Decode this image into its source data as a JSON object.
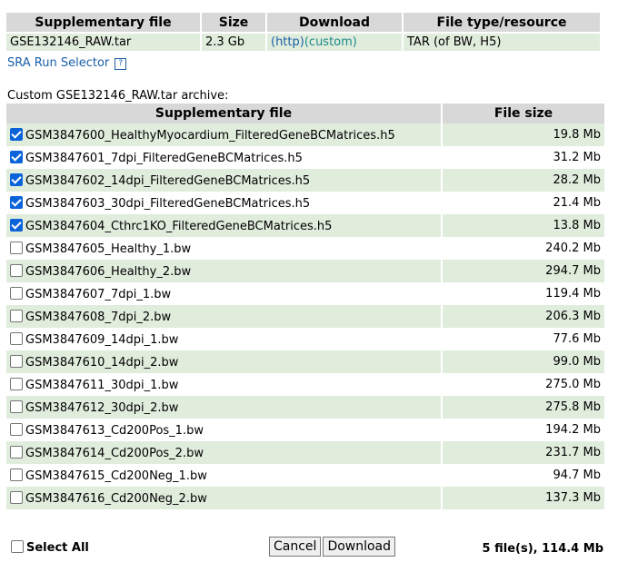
{
  "top_table": {
    "headers": [
      "Supplementary file",
      "Size",
      "Download",
      "File type/resource"
    ],
    "row": {
      "file": "GSE132146_RAW.tar",
      "size": "2.3 Gb",
      "http": "(http)",
      "custom": "(custom)",
      "type": "TAR (of BW, H5)"
    }
  },
  "sra_link": "SRA Run Selector",
  "help_glyph": "?",
  "archive_caption": "Custom GSE132146_RAW.tar archive:",
  "file_table": {
    "headers": [
      "Supplementary file",
      "File size"
    ],
    "rows": [
      {
        "name": "GSM3847600_HealthyMyocardium_FilteredGeneBCMatrices.h5",
        "size": "19.8 Mb",
        "checked": true
      },
      {
        "name": "GSM3847601_7dpi_FilteredGeneBCMatrices.h5",
        "size": "31.2 Mb",
        "checked": true
      },
      {
        "name": "GSM3847602_14dpi_FilteredGeneBCMatrices.h5",
        "size": "28.2 Mb",
        "checked": true
      },
      {
        "name": "GSM3847603_30dpi_FilteredGeneBCMatrices.h5",
        "size": "21.4 Mb",
        "checked": true
      },
      {
        "name": "GSM3847604_Cthrc1KO_FilteredGeneBCMatrices.h5",
        "size": "13.8 Mb",
        "checked": true
      },
      {
        "name": "GSM3847605_Healthy_1.bw",
        "size": "240.2 Mb",
        "checked": false
      },
      {
        "name": "GSM3847606_Healthy_2.bw",
        "size": "294.7 Mb",
        "checked": false
      },
      {
        "name": "GSM3847607_7dpi_1.bw",
        "size": "119.4 Mb",
        "checked": false
      },
      {
        "name": "GSM3847608_7dpi_2.bw",
        "size": "206.3 Mb",
        "checked": false
      },
      {
        "name": "GSM3847609_14dpi_1.bw",
        "size": "77.6 Mb",
        "checked": false
      },
      {
        "name": "GSM3847610_14dpi_2.bw",
        "size": "99.0 Mb",
        "checked": false
      },
      {
        "name": "GSM3847611_30dpi_1.bw",
        "size": "275.0 Mb",
        "checked": false
      },
      {
        "name": "GSM3847612_30dpi_2.bw",
        "size": "275.8 Mb",
        "checked": false
      },
      {
        "name": "GSM3847613_Cd200Pos_1.bw",
        "size": "194.2 Mb",
        "checked": false
      },
      {
        "name": "GSM3847614_Cd200Pos_2.bw",
        "size": "231.7 Mb",
        "checked": false
      },
      {
        "name": "GSM3847615_Cd200Neg_1.bw",
        "size": "94.7 Mb",
        "checked": false
      },
      {
        "name": "GSM3847616_Cd200Neg_2.bw",
        "size": "137.3 Mb",
        "checked": false
      }
    ]
  },
  "footer": {
    "select_all": "Select All",
    "select_all_checked": false,
    "cancel": "Cancel",
    "download": "Download",
    "total": "5 file(s), 114.4 Mb"
  },
  "colors": {
    "header_bg": "#d8d8d8",
    "row_green": "#e0ecdc",
    "link": "#1a5fa8",
    "checkbox_checked": "#0a63d8"
  }
}
